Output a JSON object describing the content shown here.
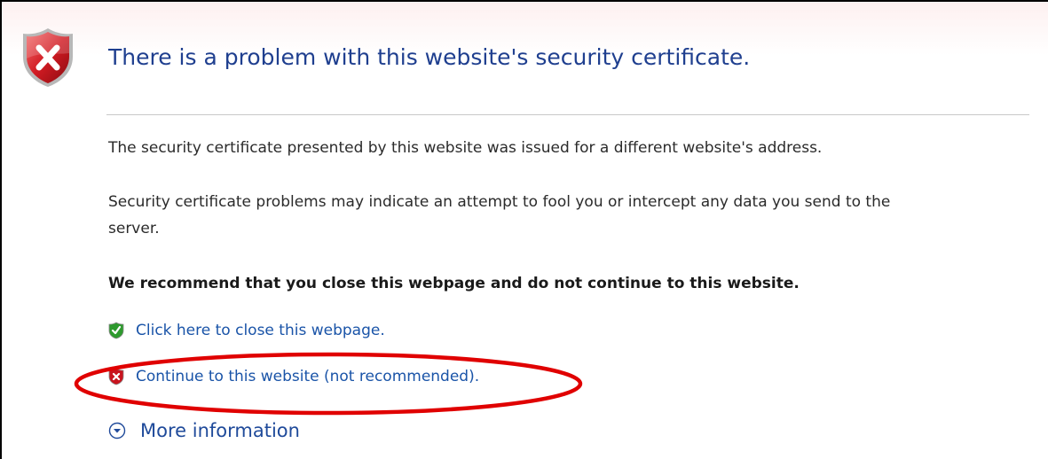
{
  "page": {
    "title": "There is a problem with this website's security certificate.",
    "paragraph_1": "The security certificate presented by this website was issued for a different website's address.",
    "paragraph_2_line_1": "Security certificate problems may indicate an attempt to fool you or intercept any data you send to the",
    "paragraph_2_line_2": "server.",
    "recommendation": "We recommend that you close this webpage and do not continue to this website."
  },
  "links": {
    "close_label": "Click here to close this webpage.",
    "continue_label": "Continue to this website (not recommended).",
    "more_info_label": "More information"
  },
  "icons": {
    "header": "shield-error-icon",
    "close": "shield-ok-icon",
    "continue": "shield-error-icon",
    "more_info": "expand-circle-icon"
  },
  "colors": {
    "title": "#1f3f8f",
    "link": "#1a54a8",
    "annotation_ellipse": "#e00000",
    "error_shield": "#c8141e",
    "ok_shield": "#2e9a2e"
  }
}
